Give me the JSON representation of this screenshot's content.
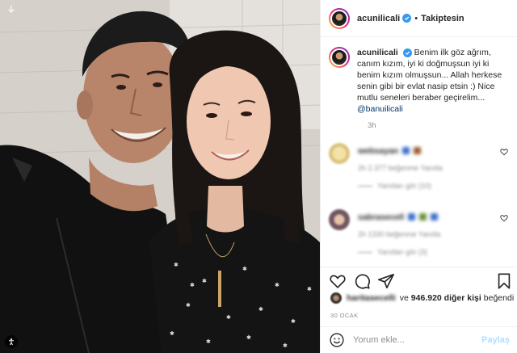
{
  "post": {
    "author": "acunilicali",
    "follow_dot": "•",
    "follow_label": "Takiptesin"
  },
  "caption": {
    "username": "acunilicali",
    "text": "Benim ilk göz ağrım, canım kızım, iyi ki doğmuşsun iyi ki benim kızım olmuşsun... Allah herkese senin gibi bir evlat nasip etsin :) Nice mutlu seneleri beraber geçirelim...",
    "mention": "@banuilicali",
    "time": "3h"
  },
  "comments": [
    {
      "username": "websayan",
      "meta": "2h  2.377 beğenme  Yanıtla",
      "replies": "Yanıtları gör (10)",
      "avatar_color": "#e6d48a"
    },
    {
      "username": "sabrasecell",
      "meta": "2h  1330 beğenme  Yanıtla",
      "replies": "Yanıtları gör (3)",
      "avatar_color": "#8b6f7a"
    }
  ],
  "likes": {
    "blurred_user": "haritasecelli",
    "connector": "ve",
    "count": "946.920 diğer kişi",
    "suffix": "beğendi"
  },
  "date": "30 OCAK",
  "add_comment": {
    "placeholder": "Yorum ekle...",
    "post_label": "Paylaş"
  },
  "colors": {
    "verified": "#3897f0",
    "link": "#00376b",
    "muted": "#8e8e8e",
    "post_disabled": "#b2dffc"
  }
}
